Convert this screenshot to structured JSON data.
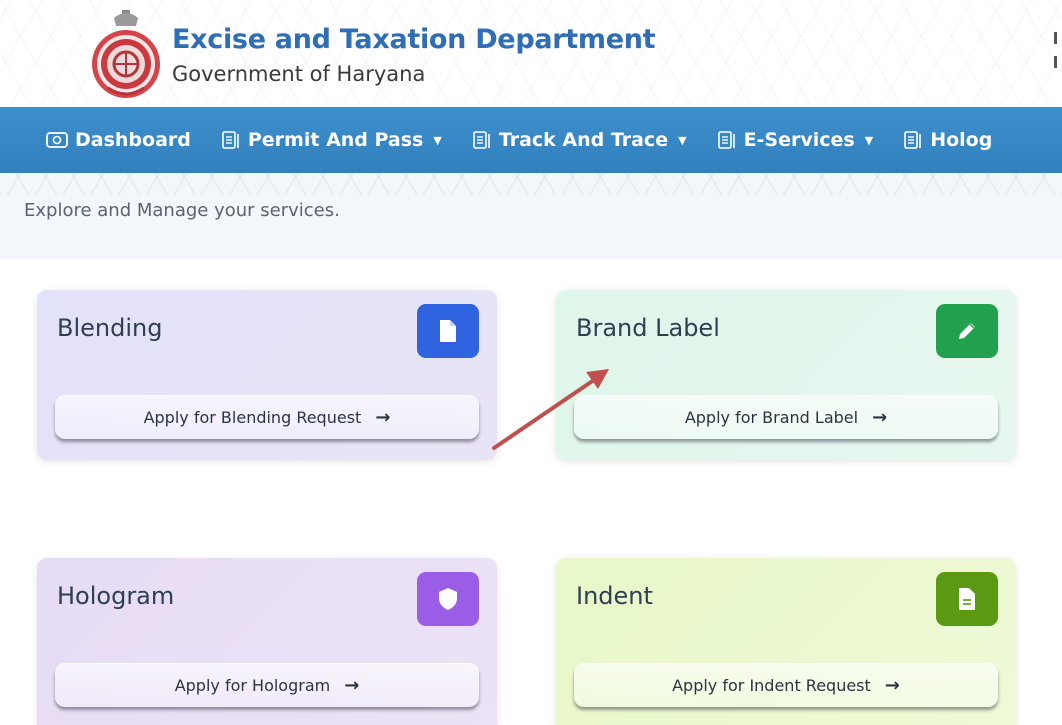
{
  "header": {
    "title": "Excise and Taxation Department",
    "subtitle": "Government of Haryana"
  },
  "nav": {
    "items": [
      {
        "label": "Dashboard",
        "icon": "dashboard-icon",
        "dropdown": false
      },
      {
        "label": "Permit And Pass",
        "icon": "document-icon",
        "dropdown": true
      },
      {
        "label": "Track And Trace",
        "icon": "document-icon",
        "dropdown": true
      },
      {
        "label": "E-Services",
        "icon": "document-icon",
        "dropdown": true
      },
      {
        "label": "Holog",
        "icon": "document-icon",
        "dropdown": false
      }
    ]
  },
  "intro": {
    "text": "Explore and Manage your services."
  },
  "cards": [
    {
      "title": "Blending",
      "button": "Apply for Blending Request",
      "icon": "file-icon",
      "icon_color": "#2f63e0"
    },
    {
      "title": "Brand Label",
      "button": "Apply for Brand Label",
      "icon": "pencil-icon",
      "icon_color": "#21a04e"
    },
    {
      "title": "Hologram",
      "button": "Apply for Hologram",
      "icon": "shield-icon",
      "icon_color": "#9b5de5"
    },
    {
      "title": "Indent",
      "button": "Apply for Indent Request",
      "icon": "document-icon",
      "icon_color": "#5a9a12"
    }
  ],
  "colors": {
    "nav_bg": "#3585c4",
    "title_blue": "#2f6db5",
    "annotation_arrow": "#c0504d"
  }
}
